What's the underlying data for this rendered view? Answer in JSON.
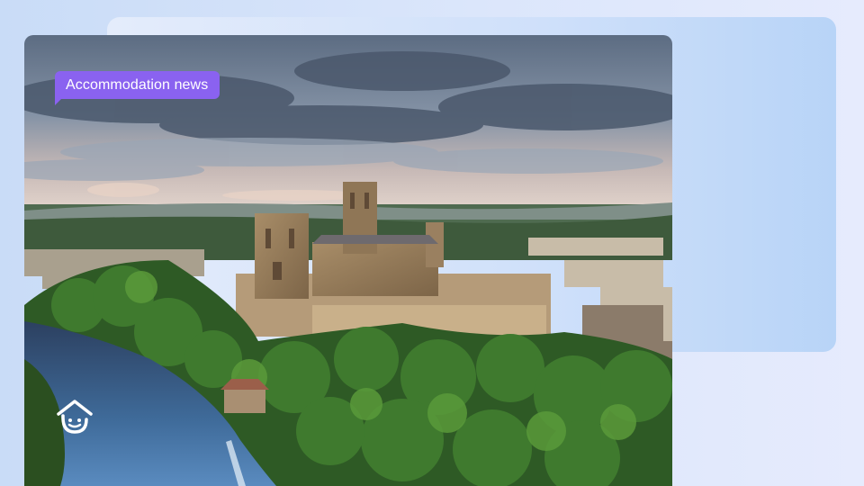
{
  "tag": {
    "label": "Accommodation news",
    "color": "#8a62f0"
  },
  "photo": {
    "subject": "aerial view of a cathedral above a wooded river bend"
  },
  "logo": {
    "icon": "house-face-icon"
  }
}
